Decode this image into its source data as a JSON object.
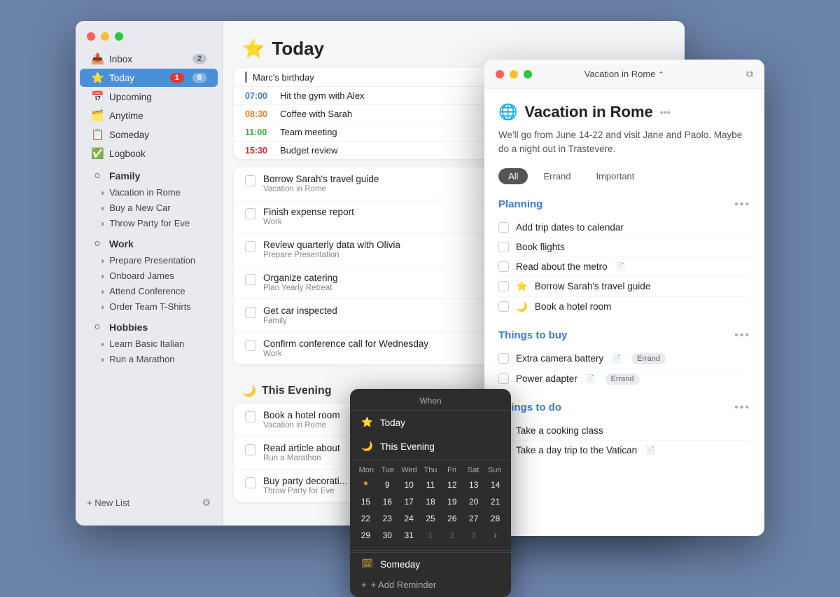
{
  "sidebar": {
    "nav_items": [
      {
        "id": "inbox",
        "icon": "📥",
        "label": "Inbox",
        "count": "2"
      },
      {
        "id": "today",
        "icon": "⭐",
        "label": "Today",
        "count_red": "1",
        "count": "8",
        "active": true
      },
      {
        "id": "upcoming",
        "icon": "📅",
        "label": "Upcoming",
        "count": ""
      },
      {
        "id": "anytime",
        "icon": "🗂️",
        "label": "Anytime",
        "count": ""
      },
      {
        "id": "someday",
        "icon": "📋",
        "label": "Someday",
        "count": ""
      },
      {
        "id": "logbook",
        "icon": "✅",
        "label": "Logbook",
        "count": ""
      }
    ],
    "groups": [
      {
        "label": "Family",
        "items": [
          "Vacation in Rome",
          "Buy a New Car",
          "Throw Party for Eve"
        ]
      },
      {
        "label": "Work",
        "items": [
          "Prepare Presentation",
          "Onboard James",
          "Attend Conference",
          "Order Team T-Shirts"
        ]
      },
      {
        "label": "Hobbies",
        "items": [
          "Learn Basic Italian",
          "Run a Marathon"
        ]
      }
    ],
    "footer": {
      "new_list": "+ New List",
      "settings_icon": "⚙"
    }
  },
  "main": {
    "header": {
      "icon": "⭐",
      "title": "Today"
    },
    "scheduled_events": [
      {
        "time": "",
        "name": "Marc's birthday",
        "color": "birthday"
      },
      {
        "time": "07:00",
        "name": "Hit the gym with Alex",
        "color": "blue"
      },
      {
        "time": "08:30",
        "name": "Coffee with Sarah",
        "color": "orange"
      },
      {
        "time": "11:00",
        "name": "Team meeting",
        "color": "green"
      },
      {
        "time": "15:30",
        "name": "Budget review",
        "color": "red"
      }
    ],
    "tasks": [
      {
        "title": "Borrow Sarah's travel guide",
        "sub": "Vacation in Rome"
      },
      {
        "title": "Finish expense report",
        "sub": "Work"
      },
      {
        "title": "Review quarterly data with Olivia",
        "sub": "Prepare Presentation"
      },
      {
        "title": "Organize catering",
        "sub": "Plan Yearly Retreat"
      },
      {
        "title": "Get car inspected",
        "sub": "Family"
      },
      {
        "title": "Confirm conference call for Wednesday",
        "sub": "Work"
      }
    ],
    "evening_section": "This Evening",
    "evening_icon": "🌙",
    "evening_tasks": [
      {
        "title": "Book a hotel room",
        "sub": "Vacation in Rome"
      },
      {
        "title": "Read article about",
        "sub": "Run a Marathon"
      },
      {
        "title": "Buy party decorati...",
        "sub": "Throw Party for Eve"
      }
    ]
  },
  "detail": {
    "titlebar": {
      "title": "Vacation in Rome",
      "chevron": "⌃"
    },
    "project_icon": "🌐",
    "project_title": "Vacation in Rome",
    "more_icon": "•••",
    "description": "We'll go from June 14-22 and visit Jane and Paolo. Maybe do a night out in Trastevere.",
    "filters": [
      "All",
      "Errand",
      "Important"
    ],
    "active_filter": "All",
    "sections": [
      {
        "title": "Planning",
        "tasks": [
          {
            "label": "Add trip dates to calendar",
            "star": false,
            "moon": false,
            "doc": false
          },
          {
            "label": "Book flights",
            "star": false,
            "moon": false,
            "doc": false
          },
          {
            "label": "Read about the metro",
            "star": false,
            "moon": false,
            "doc": true
          },
          {
            "label": "Borrow Sarah's travel guide",
            "star": true,
            "moon": false,
            "doc": false
          },
          {
            "label": "Book a hotel room",
            "star": false,
            "moon": true,
            "doc": false
          }
        ]
      },
      {
        "title": "Things to buy",
        "tasks": [
          {
            "label": "Extra camera battery",
            "tag": "Errand",
            "doc": true
          },
          {
            "label": "Power adapter",
            "tag": "Errand",
            "doc": true
          }
        ]
      },
      {
        "title": "Things to do",
        "tasks": [
          {
            "label": "Take a cooking class",
            "doc": false
          },
          {
            "label": "Take a day trip to the Vatican",
            "doc": true
          }
        ]
      }
    ]
  },
  "when_popup": {
    "header": "When",
    "options": [
      {
        "icon": "⭐",
        "label": "Today",
        "icon_class": "star"
      },
      {
        "icon": "🌙",
        "label": "This Evening",
        "icon_class": "moon"
      }
    ],
    "calendar": {
      "days_header": [
        "Mon",
        "Tue",
        "Wed",
        "Thu",
        "Fri",
        "Sat",
        "Sun"
      ],
      "weeks": [
        [
          {
            "n": "★",
            "special": "star-dot"
          },
          {
            "n": "9"
          },
          {
            "n": "10"
          },
          {
            "n": "11"
          },
          {
            "n": "12"
          },
          {
            "n": "13"
          },
          {
            "n": "14"
          }
        ],
        [
          {
            "n": "15"
          },
          {
            "n": "16"
          },
          {
            "n": "17"
          },
          {
            "n": "18"
          },
          {
            "n": "19"
          },
          {
            "n": "20"
          },
          {
            "n": "21"
          }
        ],
        [
          {
            "n": "22"
          },
          {
            "n": "23"
          },
          {
            "n": "24"
          },
          {
            "n": "25"
          },
          {
            "n": "26"
          },
          {
            "n": "27"
          },
          {
            "n": "28"
          }
        ],
        [
          {
            "n": "29"
          },
          {
            "n": "30"
          },
          {
            "n": "31"
          },
          {
            "n": "1",
            "dimmed": true
          },
          {
            "n": "2",
            "dimmed": true
          },
          {
            "n": "3",
            "dimmed": true
          },
          {
            "n": ">",
            "nav": true
          }
        ]
      ]
    },
    "someday_label": "Someday",
    "add_reminder": "+ Add Reminder"
  }
}
